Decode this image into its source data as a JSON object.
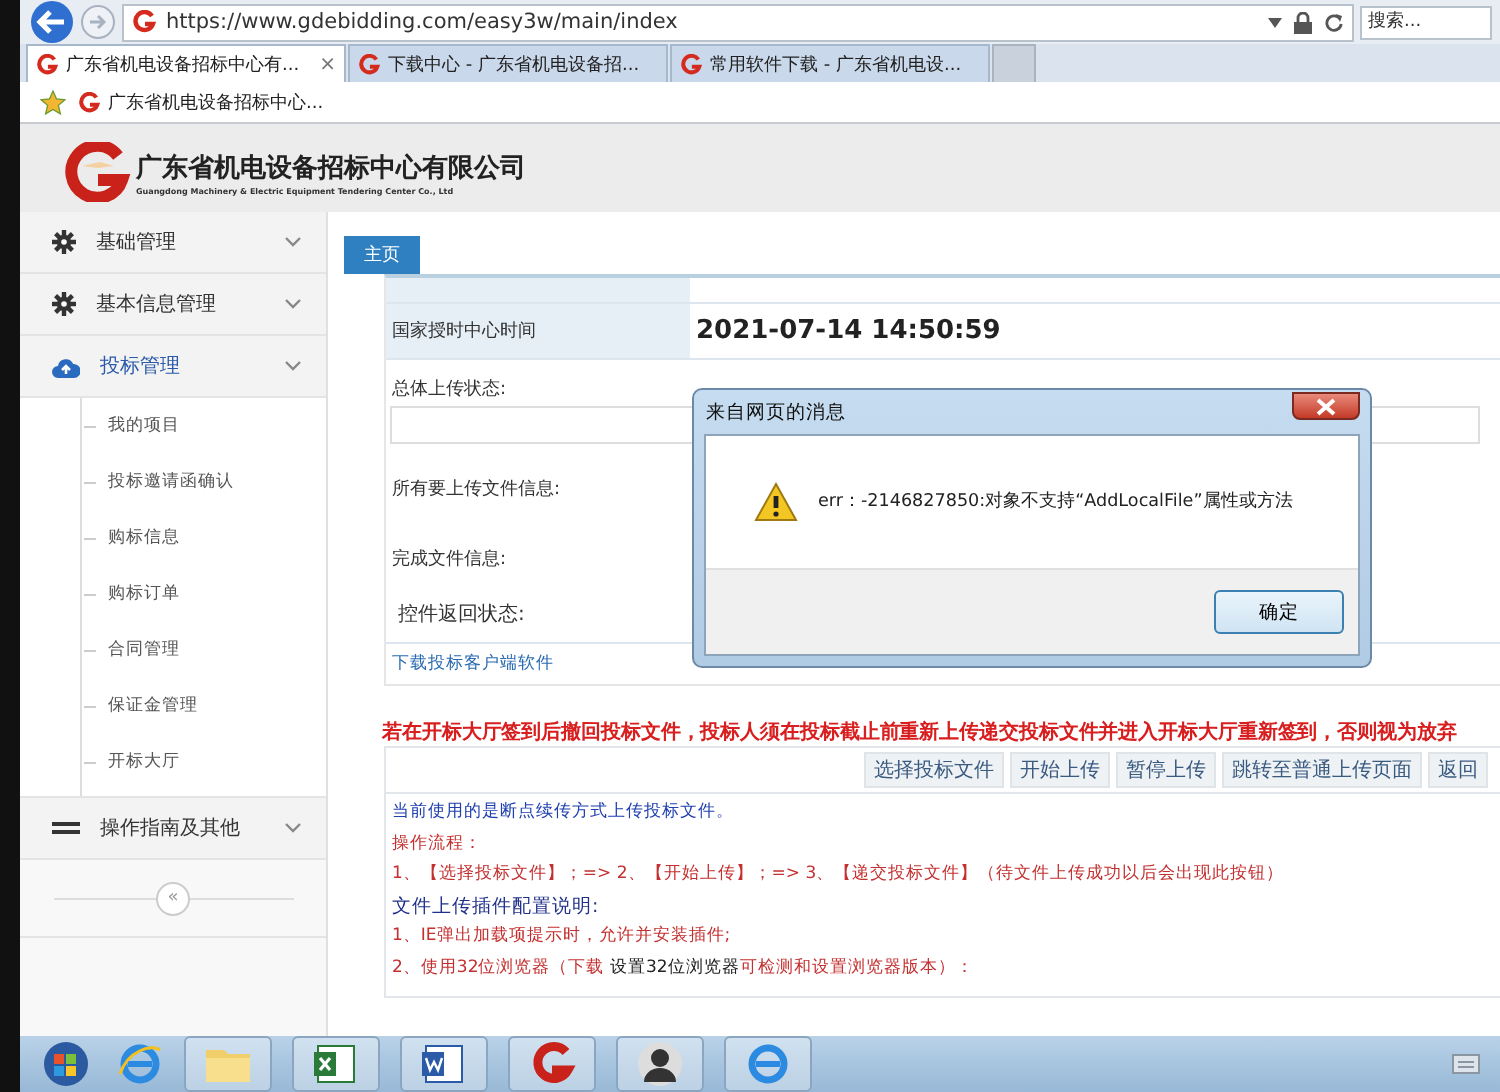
{
  "browser": {
    "url": "https://www.gdebidding.com/easy3w/main/index",
    "search": {
      "placeholder": "搜索..."
    },
    "tabs": [
      {
        "label": "广东省机电设备招标中心有...",
        "selected": true,
        "close": "×"
      },
      {
        "label": "下载中心 - 广东省机电设备招...",
        "selected": false
      },
      {
        "label": "常用软件下载 - 广东省机电设...",
        "selected": false
      }
    ],
    "favorites": [
      "广东省机电设备招标中心..."
    ]
  },
  "header": {
    "company": "广东省机电设备招标中心有限公司",
    "subtitle": "Guangdong Machinery & Electric Equipment Tendering Center Co., Ltd"
  },
  "sidebar": {
    "items": [
      {
        "label": "基础管理",
        "expanded": false
      },
      {
        "label": "基本信息管理",
        "expanded": false
      },
      {
        "label": "投标管理",
        "expanded": true,
        "children": [
          {
            "label": "我的项目"
          },
          {
            "label": "投标邀请函确认"
          },
          {
            "label": "购标信息"
          },
          {
            "label": "购标订单"
          },
          {
            "label": "合同管理"
          },
          {
            "label": "保证金管理"
          },
          {
            "label": "开标大厅"
          }
        ]
      },
      {
        "label": "操作指南及其他",
        "expanded": false
      }
    ],
    "collapse": "«"
  },
  "content": {
    "tabs": [
      {
        "label": "主页",
        "selected": true
      }
    ],
    "time_row": {
      "label": "国家授时中心时间",
      "value": "2021-07-14 14:50:59"
    },
    "upload_status": {
      "label": "总体上传状态:"
    },
    "file_labels": [
      "所有要上传文件信息:",
      "完成文件信息:"
    ],
    "control_status": "控件返回状态:",
    "download_link": "下载投标客户端软件",
    "notice": "若在开标大厅签到后撤回投标文件，投标人须在投标截止前重新上传递交投标文件并进入开标大厅重新签到，否则视为放弃",
    "buttons": [
      "选择投标文件",
      "开始上传",
      "暂停上传",
      "跳转至普通上传页面",
      "返回"
    ],
    "instructions": [
      {
        "kind": "note",
        "text": "当前使用的是断点续传方式上传投标文件。"
      },
      {
        "kind": "step",
        "text": "操作流程："
      },
      {
        "kind": "step",
        "text": "1、【选择投标文件】；=> 2、【开始上传】；=> 3、【递交投标文件】（待文件上传成功以后会出现此按钮）"
      },
      {
        "kind": "heading",
        "text": "文件上传插件配置说明:"
      },
      {
        "kind": "step",
        "text": "1、IE弹出加载项提示时，允许并安装插件;"
      },
      {
        "kind": "step",
        "text": "2、使用32位浏览器（下载 ",
        "link": "设置32位浏览器",
        "after": "可检测和设置浏览器版本）："
      }
    ]
  },
  "dialog": {
    "title": "来自网页的消息",
    "message": "err：-2146827850:对象不支持“AddLocalFile”属性或方法",
    "ok": "确定"
  }
}
